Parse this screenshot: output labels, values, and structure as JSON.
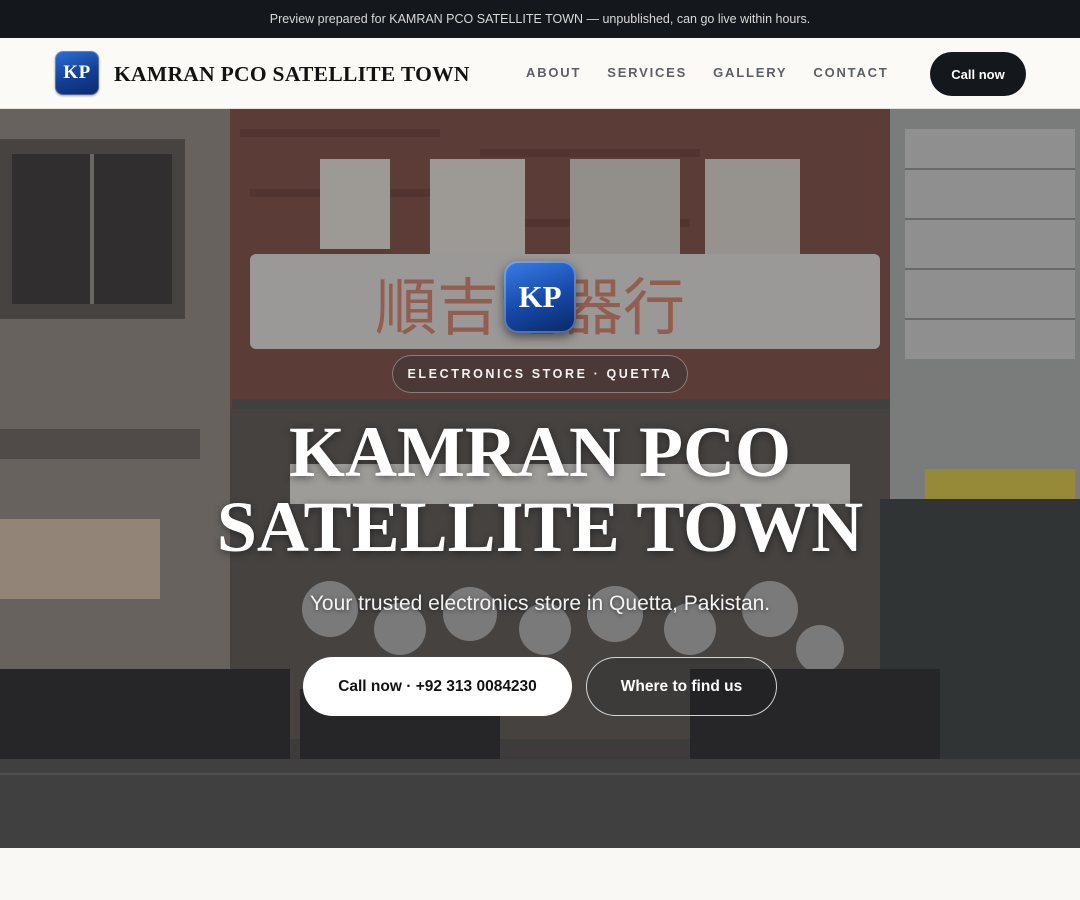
{
  "topbar": {
    "notice": "Preview prepared for KAMRAN PCO SATELLITE TOWN — unpublished, can go live within hours."
  },
  "header": {
    "logo_initials": "KP",
    "brand_name": "KAMRAN PCO SATELLITE TOWN",
    "nav": [
      {
        "label": "ABOUT"
      },
      {
        "label": "SERVICES"
      },
      {
        "label": "GALLERY"
      },
      {
        "label": "CONTACT"
      }
    ],
    "call_button": "Call now"
  },
  "hero": {
    "logo_initials": "KP",
    "category_pill": "ELECTRONICS STORE · QUETTA",
    "title_line1": "KAMRAN PCO",
    "title_line2": "SATELLITE TOWN",
    "subtitle": "Your trusted electronics store in Quetta, Pakistan.",
    "primary_button": "Call now · +92 313 0084230",
    "secondary_button": "Where to find us",
    "background_image": "storefront-street-photo"
  },
  "colors": {
    "dark": "#14171c",
    "nav_text": "#5c5f66",
    "logo_blue": "#1548a8",
    "page_bg": "#f8f7f3"
  }
}
